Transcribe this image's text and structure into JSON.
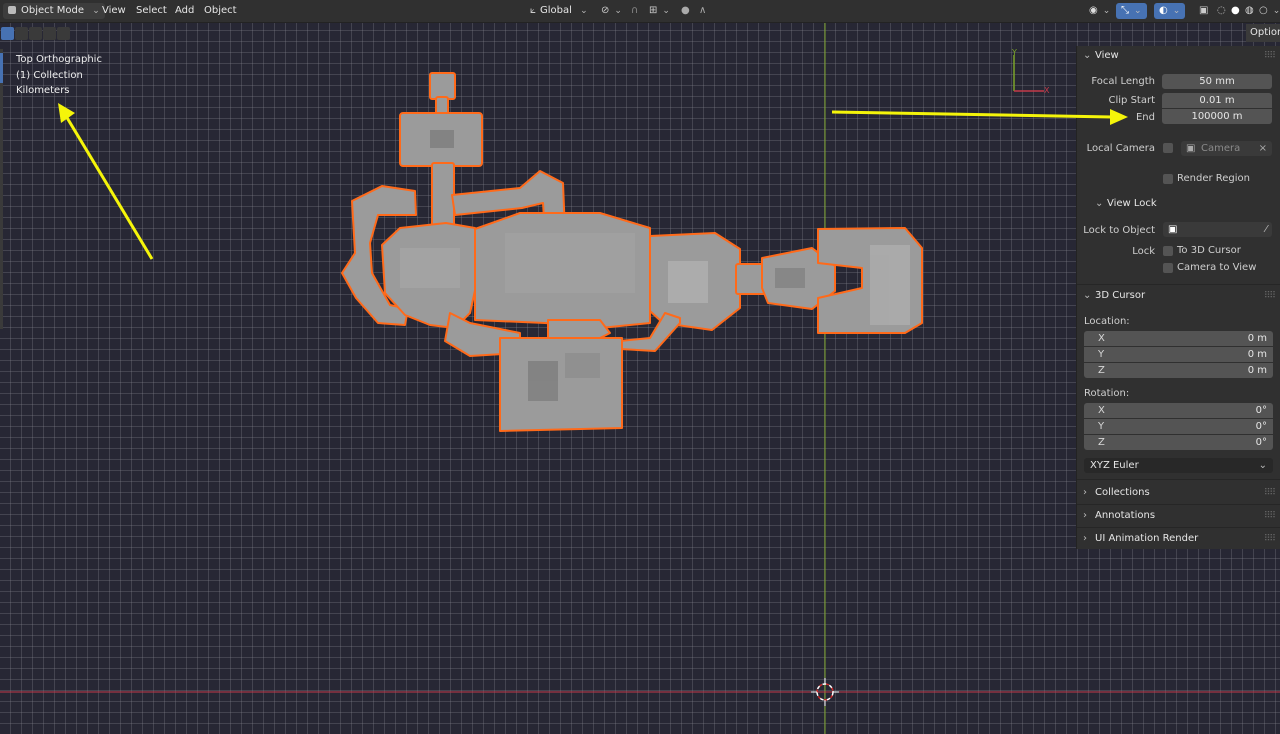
{
  "header": {
    "mode": "Object Mode",
    "menu": [
      "View",
      "Select",
      "Add",
      "Object"
    ],
    "orientation": "Global"
  },
  "overlay": {
    "view_name": "Top Orthographic",
    "collection": "(1) Collection",
    "units": "Kilometers"
  },
  "options_label": "Options",
  "sidebar": {
    "view": {
      "title": "View",
      "focal_length_label": "Focal Length",
      "focal_length": "50 mm",
      "clip_start_label": "Clip Start",
      "clip_start": "0.01 m",
      "clip_end_label": "End",
      "clip_end": "100000 m",
      "local_camera_label": "Local Camera",
      "camera_placeholder": "Camera",
      "render_region_label": "Render Region"
    },
    "view_lock": {
      "title": "View Lock",
      "lock_to_object_label": "Lock to Object",
      "lock_label": "Lock",
      "to_3d_cursor_label": "To 3D Cursor",
      "camera_to_view_label": "Camera to View"
    },
    "cursor": {
      "title": "3D Cursor",
      "location_label": "Location:",
      "loc_x": "0 m",
      "loc_y": "0 m",
      "loc_z": "0 m",
      "rotation_label": "Rotation:",
      "rot_x": "0°",
      "rot_y": "0°",
      "rot_z": "0°",
      "rotation_mode": "XYZ Euler"
    },
    "collapsed_panels": [
      "Collections",
      "Annotations",
      "UI Animation Render"
    ],
    "axes": [
      "X",
      "Y",
      "Z"
    ]
  },
  "colors": {
    "selection_outline": "#ff6a1a",
    "mesh": "#9b9b9b",
    "x_axis": "#c33a4a",
    "y_axis": "#7ba32a",
    "annotation_arrow": "#f5f50a",
    "accent": "#4772b3"
  }
}
